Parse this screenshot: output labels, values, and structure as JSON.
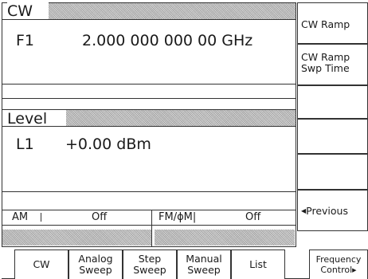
{
  "cw_section": {
    "title": "CW",
    "param_label": "F1",
    "param_value": "2.000 000 000 00 GHz"
  },
  "level_section": {
    "title": "Level",
    "param_label": "L1",
    "param_value": "+0.00 dBm"
  },
  "status": {
    "am_label": "AM",
    "am_value": "Off",
    "fm_label": "FM/ϕM|",
    "fm_value": "Off"
  },
  "softkeys": [
    {
      "line1": "CW Ramp",
      "line2": ""
    },
    {
      "line1": "CW Ramp",
      "line2": "Swp Time"
    },
    {
      "line1": "",
      "line2": ""
    },
    {
      "line1": "",
      "line2": ""
    },
    {
      "line1": "",
      "line2": ""
    },
    {
      "line1": "Previous",
      "line2": ""
    }
  ],
  "tabs": [
    {
      "line1": "CW",
      "line2": ""
    },
    {
      "line1": "Analog",
      "line2": "Sweep"
    },
    {
      "line1": "Step",
      "line2": "Sweep"
    },
    {
      "line1": "Manual",
      "line2": "Sweep"
    },
    {
      "line1": "List",
      "line2": ""
    },
    {
      "line1": "Frequency",
      "line2": "Control"
    }
  ],
  "icons": {
    "previous": "left-triangle-icon",
    "more": "right-triangle-icon"
  }
}
